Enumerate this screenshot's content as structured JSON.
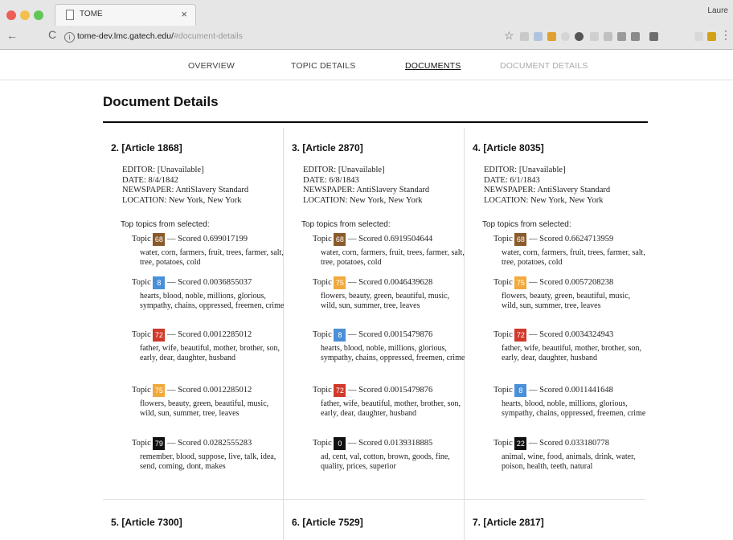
{
  "browser": {
    "tab_title": "TOME",
    "tab_close": "×",
    "user_name": "Laure",
    "url_main": "tome-dev.lmc.gatech.edu/",
    "url_fragment": "#document-details",
    "back": "←",
    "reload": "C",
    "star": "☆",
    "menu": "⋮"
  },
  "nav": [
    "OVERVIEW",
    "TOPIC DETAILS",
    "DOCUMENTS",
    "DOCUMENT DETAILS"
  ],
  "page_title": "Document Details",
  "top_label": "Top topics from selected:",
  "colors": {
    "brown": "#8b5a2b",
    "blue": "#4a90d9",
    "red": "#d0392b",
    "orange": "#f2a93b",
    "black": "#111111",
    "active_nav": "#111111",
    "disabled_nav": "#aaaaaa"
  },
  "articles": [
    {
      "heading": "2. [Article 1868]",
      "editor": "EDITOR: [Unavailable]",
      "date": "DATE: 8/4/1842",
      "newspaper": "NEWSPAPER: AntiSlavery Standard",
      "location": "LOCATION: New York, New York",
      "topics": [
        {
          "label": "Topic",
          "num": "68",
          "color": "#8b5a2b",
          "score": "— Scored 0.699017199",
          "words": "water, corn, farmers, fruit, trees, farmer, salt, tree, potatoes, cold"
        },
        {
          "label": "Topic",
          "num": "8",
          "color": "#4a90d9",
          "score": "— Scored 0.0036855037",
          "words": "hearts, blood, noble, millions, glorious, sympathy, chains, oppressed, freemen, crime"
        },
        {
          "label": "Topic",
          "num": "72",
          "color": "#d0392b",
          "score": "— Scored 0.0012285012",
          "words": "father, wife, beautiful, mother, brother, son, early, dear, daughter, husband"
        },
        {
          "label": "Topic",
          "num": "75",
          "color": "#f2a93b",
          "score": "— Scored 0.0012285012",
          "words": "flowers, beauty, green, beautiful, music, wild, sun, summer, tree, leaves"
        },
        {
          "label": "Topic",
          "num": "79",
          "color": "#111111",
          "score": "— Scored 0.0282555283",
          "words": "remember, blood, suppose, live, talk, idea, send, coming, dont, makes"
        }
      ]
    },
    {
      "heading": "3. [Article 2870]",
      "editor": "EDITOR: [Unavailable]",
      "date": "DATE: 6/8/1843",
      "newspaper": "NEWSPAPER: AntiSlavery Standard",
      "location": "LOCATION: New York, New York",
      "topics": [
        {
          "label": "Topic",
          "num": "68",
          "color": "#8b5a2b",
          "score": "— Scored 0.6919504644",
          "words": "water, corn, farmers, fruit, trees, farmer, salt, tree, potatoes, cold"
        },
        {
          "label": "Topic",
          "num": "75",
          "color": "#f2a93b",
          "score": "— Scored 0.0046439628",
          "words": "flowers, beauty, green, beautiful, music, wild, sun, summer, tree, leaves"
        },
        {
          "label": "Topic",
          "num": "8",
          "color": "#4a90d9",
          "score": "— Scored 0.0015479876",
          "words": "hearts, blood, noble, millions, glorious, sympathy, chains, oppressed, freemen, crime"
        },
        {
          "label": "Topic",
          "num": "72",
          "color": "#d0392b",
          "score": "— Scored 0.0015479876",
          "words": "father, wife, beautiful, mother, brother, son, early, dear, daughter, husband"
        },
        {
          "label": "Topic",
          "num": "0",
          "color": "#111111",
          "score": "— Scored 0.0139318885",
          "words": "ad, cent, val, cotton, brown, goods, fine, quality, prices, superior"
        }
      ]
    },
    {
      "heading": "4. [Article 8035]",
      "editor": "EDITOR: [Unavailable]",
      "date": "DATE: 6/1/1843",
      "newspaper": "NEWSPAPER: AntiSlavery Standard",
      "location": "LOCATION: New York, New York",
      "topics": [
        {
          "label": "Topic",
          "num": "68",
          "color": "#8b5a2b",
          "score": "— Scored 0.6624713959",
          "words": "water, corn, farmers, fruit, trees, farmer, salt, tree, potatoes, cold"
        },
        {
          "label": "Topic",
          "num": "75",
          "color": "#f2a93b",
          "score": "— Scored 0.0057208238",
          "words": "flowers, beauty, green, beautiful, music, wild, sun, summer, tree, leaves"
        },
        {
          "label": "Topic",
          "num": "72",
          "color": "#d0392b",
          "score": "— Scored 0.0034324943",
          "words": "father, wife, beautiful, mother, brother, son, early, dear, daughter, husband"
        },
        {
          "label": "Topic",
          "num": "8",
          "color": "#4a90d9",
          "score": "— Scored 0.0011441648",
          "words": "hearts, blood, noble, millions, glorious, sympathy, chains, oppressed, freemen, crime"
        },
        {
          "label": "Topic",
          "num": "22",
          "color": "#111111",
          "score": "— Scored 0.033180778",
          "words": "animal, wine, food, animals, drink, water, poison, health, teeth, natural"
        }
      ]
    }
  ],
  "next_articles": [
    "5. [Article 7300]",
    "6. [Article 7529]",
    "7. [Article 2817]"
  ]
}
